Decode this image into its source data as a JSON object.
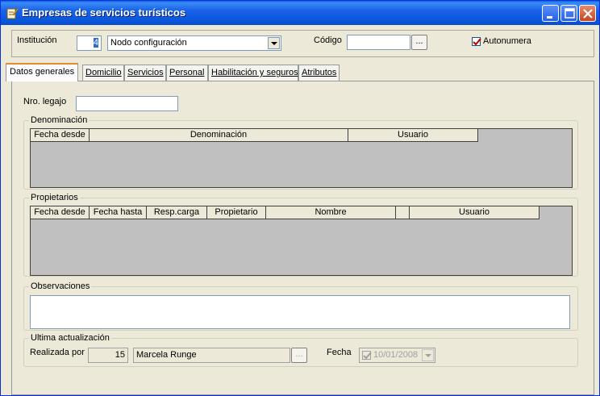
{
  "window": {
    "title": "Empresas de servicios turísticos",
    "icon": "notepad-pen-icon"
  },
  "header": {
    "institucion_label": "Institución",
    "institucion_code": "4",
    "institucion_name": "Nodo configuración",
    "codigo_label": "Código",
    "codigo_value": "",
    "ellipsis": "...",
    "autonumera_label": "Autonumera",
    "autonumera_checked": true
  },
  "tabs": [
    {
      "label": "Datos generales",
      "active": true
    },
    {
      "label": "Domicilio"
    },
    {
      "label": "Servicios"
    },
    {
      "label": "Personal"
    },
    {
      "label": "Habilitación y seguros"
    },
    {
      "label": "Atributos"
    }
  ],
  "legajo": {
    "label": "Nro. legajo",
    "value": ""
  },
  "denominacion": {
    "title": "Denominación",
    "columns": [
      "Fecha desde",
      "Denominación",
      "Usuario"
    ]
  },
  "propietarios": {
    "title": "Propietarios",
    "columns": [
      "Fecha desde",
      "Fecha hasta",
      "Resp.carga",
      "Propietario",
      "Nombre",
      "",
      "Usuario"
    ]
  },
  "observaciones": {
    "title": "Observaciones",
    "value": ""
  },
  "ultima": {
    "title": "Ultima actualización",
    "realizada_label": "Realizada por",
    "user_id": "15",
    "user_name": "Marcela Runge",
    "ellipsis": "...",
    "fecha_label": "Fecha",
    "fecha_value": "10/01/2008",
    "fecha_checked": true
  },
  "colors": {
    "title_bar": "#0754d9",
    "tab_highlight": "#e68b2c",
    "grid_bg": "#c0c0c0"
  }
}
